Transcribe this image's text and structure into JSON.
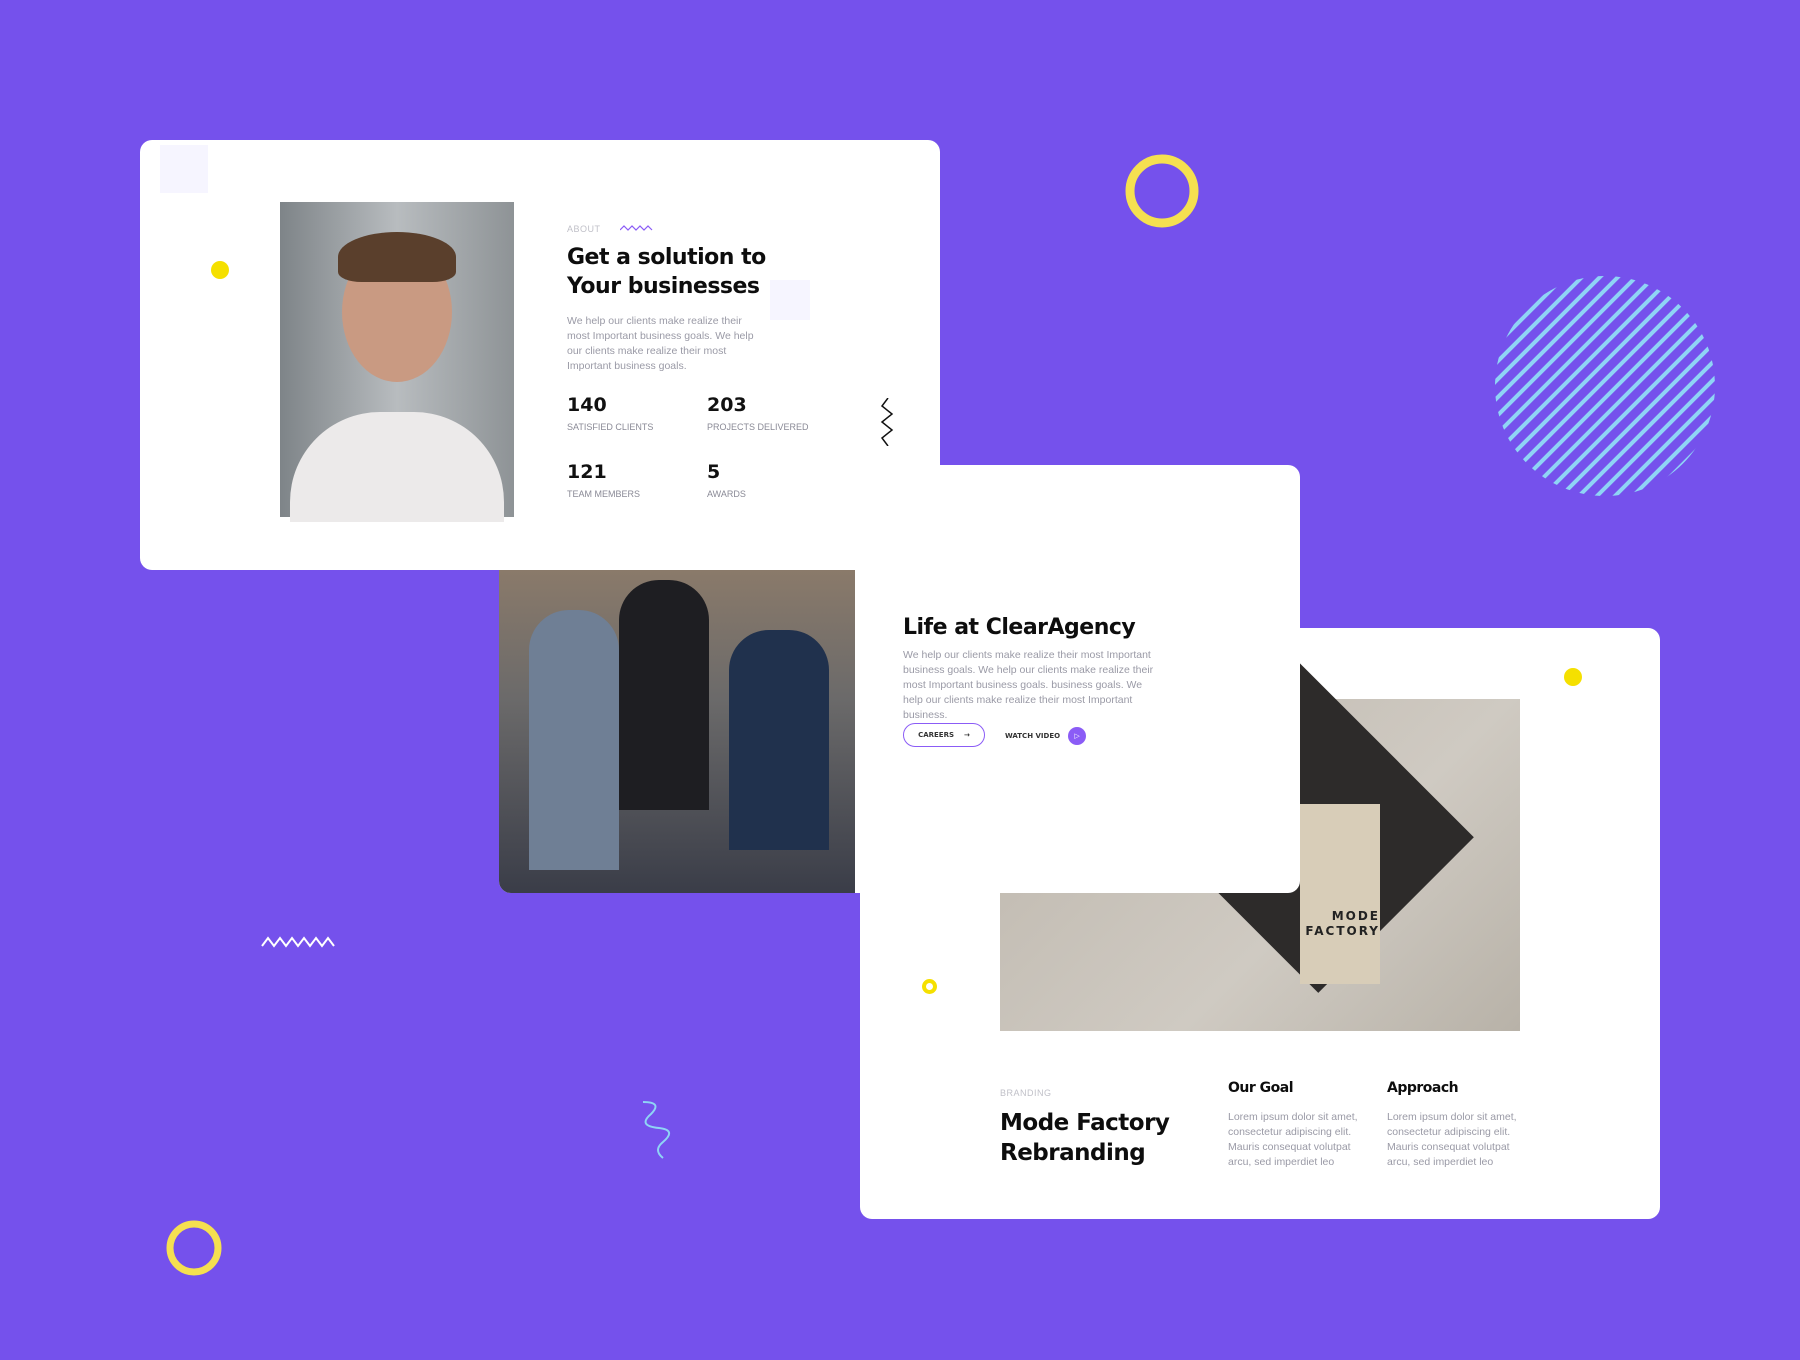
{
  "about": {
    "eyebrow": "ABOUT",
    "title_line1": "Get a solution to",
    "title_line2": "Your businesses",
    "text": "We help our clients make realize their most Important business goals. We help our clients make realize their most Important business goals.",
    "stats": [
      {
        "value": "140",
        "label": "SATISFIED CLIENTS"
      },
      {
        "value": "203",
        "label": "PROJECTS DELIVERED"
      },
      {
        "value": "121",
        "label": "TEAM MEMBERS"
      },
      {
        "value": "5",
        "label": "AWARDS"
      }
    ]
  },
  "life": {
    "title": "Life at ClearAgency",
    "text": "We help our clients make realize their most Important business goals. We help our clients make realize their most Important business goals. business goals. We help our clients make realize their most Important business.",
    "careers_label": "CAREERS",
    "watch_label": "WATCH VIDEO"
  },
  "branding": {
    "eyebrow": "BRANDING",
    "title_line1": "Mode Factory",
    "title_line2": "Rebranding",
    "card_text": "MODE FACTORY",
    "columns": [
      {
        "heading": "Our Goal",
        "text": "Lorem ipsum dolor sit amet, consectetur adipiscing elit. Mauris consequat volutpat arcu, sed imperdiet leo"
      },
      {
        "heading": "Approach",
        "text": "Lorem ipsum dolor sit amet, consectetur adipiscing elit. Mauris consequat volutpat arcu, sed imperdiet leo"
      }
    ]
  },
  "colors": {
    "background": "#7551ec",
    "accent": "#8b5cf6",
    "yellow": "#f5e050",
    "stripes": "#8fd4f5"
  }
}
